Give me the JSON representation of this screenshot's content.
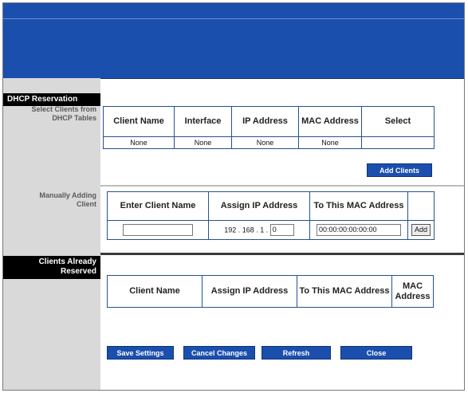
{
  "sidebar": {
    "dhcp_reservation": "DHCP Reservation",
    "select_clients": "Select Clients from\nDHCP Tables",
    "manually_adding": "Manually Adding\nClient",
    "clients_reserved": "Clients Already\nReserved"
  },
  "dhcp_table": {
    "headers": [
      "Client Name",
      "Interface",
      "IP Address",
      "MAC Address",
      "Select"
    ],
    "row": [
      "None",
      "None",
      "None",
      "None",
      ""
    ]
  },
  "add_clients_label": "Add Clients",
  "manual_table": {
    "headers": [
      "Enter Client Name",
      "Assign IP Address",
      "To This MAC Address"
    ],
    "client_name_value": "",
    "ip_prefix": "192 . 168 . 1 .",
    "ip_last_octet": "0",
    "mac_value": "00:00:00:00:00:00",
    "add_label": "Add"
  },
  "reserved_table": {
    "headers": [
      "Client Name",
      "Assign IP Address",
      "To This MAC Address",
      "MAC Address"
    ]
  },
  "buttons": {
    "save": "Save Settings",
    "cancel": "Cancel Changes",
    "refresh": "Refresh",
    "close": "Close"
  },
  "colors": {
    "banner": "#1a4fae",
    "button": "#1a4fae",
    "table_border": "#26518f"
  }
}
